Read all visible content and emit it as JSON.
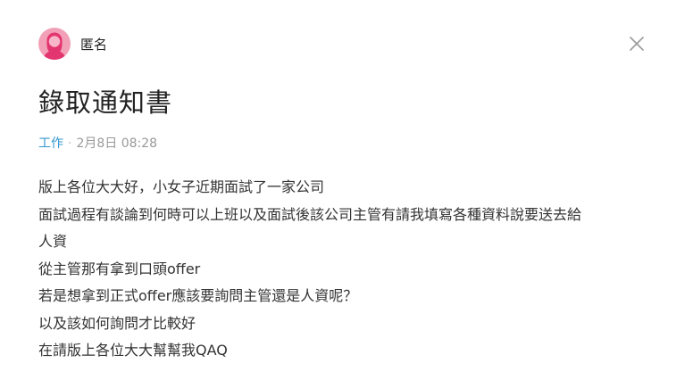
{
  "author": {
    "name": "匿名",
    "avatar_icon": "female-avatar-icon",
    "avatar_color": "#f2a0b8"
  },
  "close_icon": "close-icon",
  "post": {
    "title": "錄取通知書",
    "board": "工作",
    "separator": "·",
    "time": "2月8日 08:28",
    "board_color": "#3397cf",
    "body_lines": [
      "版上各位大大好，小女子近期面試了一家公司",
      "面試過程有談論到何時可以上班以及面試後該公司主管有請我填寫各種資料說要送去給",
      "人資",
      "從主管那有拿到口頭offer",
      "若是想拿到正式offer應該要詢問主管還是人資呢？",
      "以及該如何詢問才比較好",
      "在請版上各位大大幫幫我QAQ"
    ]
  }
}
